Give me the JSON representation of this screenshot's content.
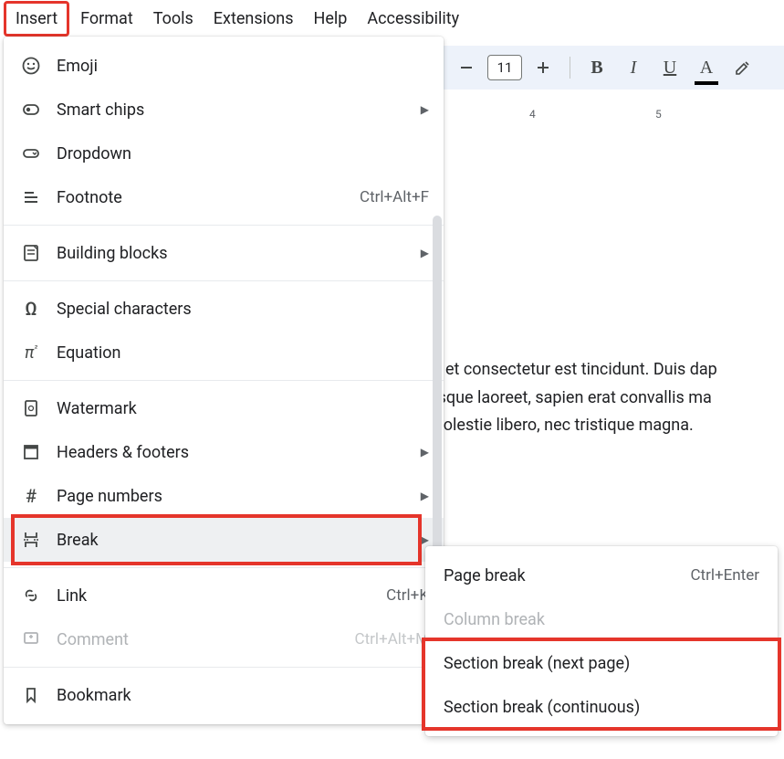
{
  "menubar": {
    "items": [
      "Insert",
      "Format",
      "Tools",
      "Extensions",
      "Help",
      "Accessibility"
    ]
  },
  "toolbar": {
    "font_size": "11"
  },
  "ruler": {
    "n4": "4",
    "n5": "5"
  },
  "doc_lines": [
    "n, et consectetur est tincidunt. Duis dap",
    "esque laoreet, sapien erat convallis ma",
    "molestie libero, nec tristique magna."
  ],
  "menu": {
    "emoji": "Emoji",
    "smart_chips": "Smart chips",
    "dropdown": "Dropdown",
    "footnote": "Footnote",
    "footnote_sc": "Ctrl+Alt+F",
    "building_blocks": "Building blocks",
    "special_chars": "Special characters",
    "equation": "Equation",
    "watermark": "Watermark",
    "headers_footers": "Headers & footers",
    "page_numbers": "Page numbers",
    "break": "Break",
    "link": "Link",
    "link_sc": "Ctrl+K",
    "comment": "Comment",
    "comment_sc": "Ctrl+Alt+M",
    "bookmark": "Bookmark"
  },
  "submenu": {
    "page_break": "Page break",
    "page_break_sc": "Ctrl+Enter",
    "column_break": "Column break",
    "section_next": "Section break (next page)",
    "section_cont": "Section break (continuous)"
  }
}
